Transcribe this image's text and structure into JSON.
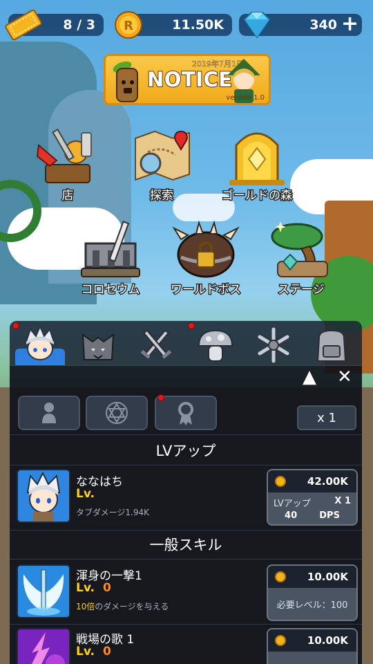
{
  "topbar": {
    "tickets": "8 / 3",
    "gold": "11.50K",
    "gems": "340",
    "gem_add_label": "+"
  },
  "notice": {
    "title": "NOTICE",
    "date": "2019年7月1日",
    "version": "version 1.0"
  },
  "menu": [
    {
      "label": "店",
      "icon": "shop-icon"
    },
    {
      "label": "探索",
      "icon": "map-icon"
    },
    {
      "label": "ゴールドの森",
      "icon": "gold-forest-icon"
    },
    {
      "label": "コロセウム",
      "icon": "colosseum-icon"
    },
    {
      "label": "ワールドボス",
      "icon": "world-boss-icon"
    },
    {
      "label": "ステージ",
      "icon": "stage-icon"
    }
  ],
  "tabs": [
    {
      "icon": "hero-tab-icon",
      "badge": true,
      "active": true
    },
    {
      "icon": "wolf-tab-icon",
      "badge": false
    },
    {
      "icon": "swords-tab-icon",
      "badge": true
    },
    {
      "icon": "mushroom-tab-icon",
      "badge": false
    },
    {
      "icon": "snowflake-tab-icon",
      "badge": false
    },
    {
      "icon": "backpack-tab-icon",
      "badge": false
    }
  ],
  "panel": {
    "collapse_label": "▲",
    "close_label": "✕",
    "multiplier": "x 1",
    "levelup_section": "LVアップ",
    "skill_section": "一般スキル"
  },
  "hero": {
    "name": "ななはち",
    "lv_label": "Lv.",
    "tap_damage": "タブダメージ1.94K",
    "cost": "42.00K",
    "action": "LVアップ",
    "action_mult": "X 1",
    "dps_value": "40",
    "dps_label": "DPS"
  },
  "skills": [
    {
      "name": "渾身の一撃1",
      "lv_label": "Lv.",
      "level": "0",
      "desc_hl": "10倍",
      "desc_rest": "のダメージを与える",
      "cost": "10.00K",
      "requirement": "必要レベル：100"
    },
    {
      "name": "戦場の歌 1",
      "lv_label": "Lv.",
      "level": "0",
      "cost": "10.00K"
    }
  ],
  "colors": {
    "accent": "#2d7fe0",
    "gold_text": "#ffd21c",
    "level_number": "#ff8a1c",
    "badge": "#e0191d"
  }
}
